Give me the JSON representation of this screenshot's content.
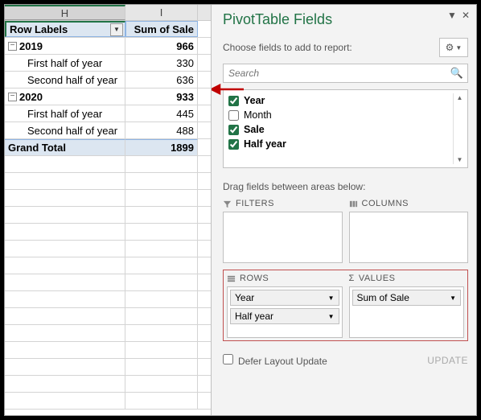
{
  "columns": {
    "H": "H",
    "I": "I"
  },
  "headers": {
    "row_labels": "Row Labels",
    "sum_of_sale": "Sum of Sale"
  },
  "data": {
    "y2019": {
      "label": "2019",
      "val": "966",
      "h1_label": "First half of year",
      "h1_val": "330",
      "h2_label": "Second half of year",
      "h2_val": "636"
    },
    "y2020": {
      "label": "2020",
      "val": "933",
      "h1_label": "First half of year",
      "h1_val": "445",
      "h2_label": "Second half of year",
      "h2_val": "488"
    },
    "grand_total": {
      "label": "Grand Total",
      "val": "1899"
    }
  },
  "pane": {
    "title": "PivotTable Fields",
    "choose_label": "Choose fields to add to report:",
    "search_placeholder": "Search",
    "fields": {
      "year": "Year",
      "month": "Month",
      "sale": "Sale",
      "half_year": "Half year"
    },
    "drag_label": "Drag fields between areas below:",
    "areas": {
      "filters": "FILTERS",
      "columns": "COLUMNS",
      "rows": "ROWS",
      "values": "VALUES"
    },
    "chips": {
      "year": "Year",
      "half_year": "Half year",
      "sum_of_sale": "Sum of Sale"
    },
    "defer": "Defer Layout Update",
    "update": "UPDATE"
  }
}
